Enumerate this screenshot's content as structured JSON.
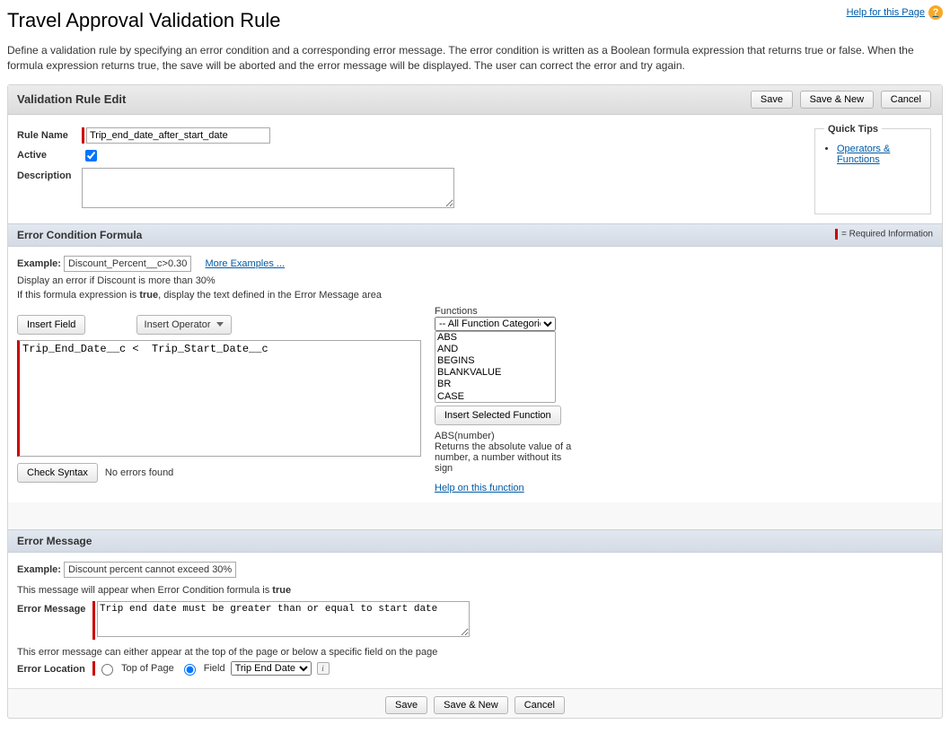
{
  "help": {
    "label": "Help for this Page"
  },
  "title": "Travel Approval Validation Rule",
  "intro": "Define a validation rule by specifying an error condition and a corresponding error message. The error condition is written as a Boolean formula expression that returns true or false. When the formula expression returns true, the save will be aborted and the error message will be displayed. The user can correct the error and try again.",
  "editHeader": "Validation Rule Edit",
  "buttons": {
    "save": "Save",
    "saveNew": "Save & New",
    "cancel": "Cancel"
  },
  "fields": {
    "ruleNameLabel": "Rule Name",
    "ruleNameValue": "Trip_end_date_after_start_date",
    "activeLabel": "Active",
    "descriptionLabel": "Description",
    "descriptionValue": ""
  },
  "quickTips": {
    "legend": "Quick Tips",
    "link1": "Operators & Functions"
  },
  "formulaSection": {
    "header": "Error Condition Formula",
    "reqNote": "= Required Information",
    "exampleLabel": "Example:",
    "exampleValue": "Discount_Percent__c>0.30",
    "moreExamples": "More Examples ...",
    "exampleDesc": "Display an error if Discount is more than 30%",
    "hintPre": "If this formula expression is ",
    "hintBold": "true",
    "hintPost": ", display the text defined in the Error Message area",
    "insertField": "Insert Field",
    "insertOperator": "Insert Operator",
    "formulaValue": "Trip_End_Date__c <  Trip_Start_Date__c",
    "checkSyntax": "Check Syntax",
    "syntaxResult": "No errors found",
    "functionsLabel": "Functions",
    "funcCategory": "-- All Function Categories",
    "funcList": [
      "ABS",
      "AND",
      "BEGINS",
      "BLANKVALUE",
      "BR",
      "CASE"
    ],
    "insertSelected": "Insert Selected Function",
    "funcSig": "ABS(number)",
    "funcDesc": "Returns the absolute value of a number, a number without its sign",
    "helpFunc": "Help on this function"
  },
  "errorSection": {
    "header": "Error Message",
    "exampleLabel": "Example:",
    "exampleValue": "Discount percent cannot exceed 30%",
    "appearPre": "This message will appear when Error Condition formula is ",
    "appearBold": "true",
    "msgLabel": "Error Message",
    "msgValue": "Trip end date must be greater than or equal to start date",
    "locationNote": "This error message can either appear at the top of the page or below a specific field on the page",
    "locationLabel": "Error Location",
    "topOfPage": "Top of Page",
    "fieldLabel": "Field",
    "fieldSelected": "Trip End Date"
  }
}
